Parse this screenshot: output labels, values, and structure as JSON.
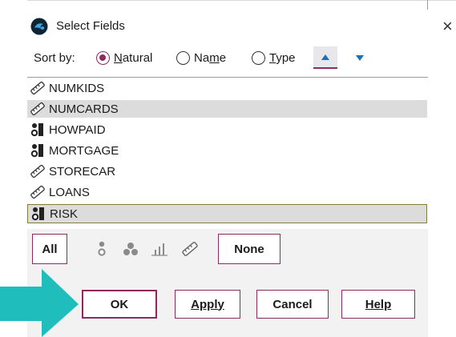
{
  "window": {
    "title": "Select Fields",
    "close_glyph": "×"
  },
  "sort": {
    "label": "Sort by:",
    "options": [
      {
        "pre": "",
        "key": "N",
        "post": "atural",
        "checked": true
      },
      {
        "pre": "Na",
        "key": "m",
        "post": "e",
        "checked": false
      },
      {
        "pre": "",
        "key": "T",
        "post": "ype",
        "checked": false
      }
    ],
    "ascending_icon": "triangle-up-icon",
    "descending_icon": "triangle-down-icon"
  },
  "fields": [
    {
      "name": "NUMKIDS",
      "icon": "ruler-icon",
      "selected": false
    },
    {
      "name": "NUMCARDS",
      "icon": "ruler-icon",
      "selected": true
    },
    {
      "name": "HOWPAID",
      "icon": "nominal-icon",
      "selected": false
    },
    {
      "name": "MORTGAGE",
      "icon": "nominal-icon",
      "selected": false
    },
    {
      "name": "STORECAR",
      "icon": "ruler-icon",
      "selected": false
    },
    {
      "name": "LOANS",
      "icon": "ruler-icon",
      "selected": false
    },
    {
      "name": "RISK",
      "icon": "nominal-icon",
      "selected": true,
      "focused": true
    }
  ],
  "filters": {
    "all_label": "All",
    "none_label": "None",
    "icons": [
      "nominal-filter-icon",
      "set-filter-icon",
      "bar-chart-icon",
      "ruler-filter-icon"
    ]
  },
  "buttons": {
    "ok": "OK",
    "apply": "Apply",
    "cancel": "Cancel",
    "help": "Help"
  },
  "colors": {
    "accent": "#8e2a63",
    "annotation_arrow": "#1fbdbb",
    "selection": "#dcdcdc"
  }
}
